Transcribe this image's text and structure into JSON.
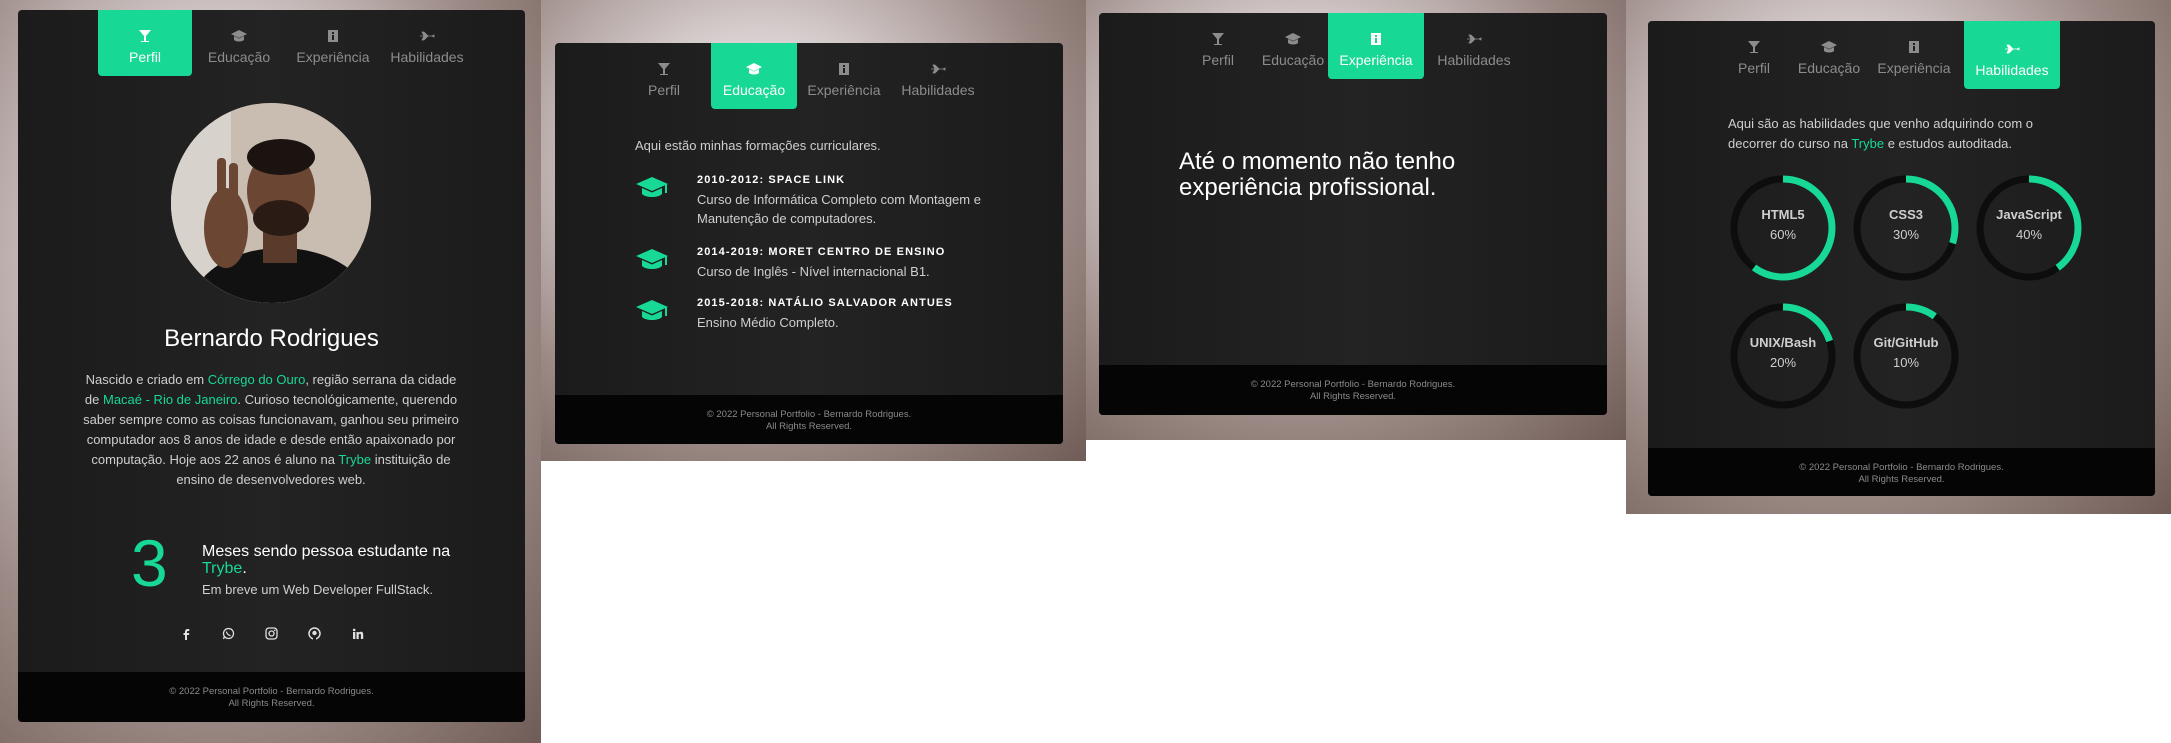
{
  "nav": [
    "Perfil",
    "Educação",
    "Experiência",
    "Habilidades"
  ],
  "profile": {
    "name": "Bernardo Rodrigues",
    "bio": [
      {
        "text": "Nascido e criado em "
      },
      {
        "text": "Córrego do Ouro",
        "hl": true
      },
      {
        "text": ", região serrana da cidade de "
      },
      {
        "text": "Macaé - Rio de Janeiro",
        "hl": true
      },
      {
        "text": ". Curioso tecnológicamente, querendo saber sempre como as coisas funcionavam, ganhou seu primeiro computador aos 8 anos de idade e desde então apaixonado por computação. Hoje aos 22 anos é aluno na "
      },
      {
        "text": "Trybe",
        "hl": true
      },
      {
        "text": " instituição de ensino de desenvolvedores web."
      }
    ],
    "months": "3",
    "months_text": "Meses sendo pessoa estudante na ",
    "months_link": "Trybe",
    "months_end": ".",
    "months_sub": "Em breve um Web Developer FullStack.",
    "social": [
      "facebook-icon",
      "whatsapp-icon",
      "instagram-icon",
      "github-icon",
      "linkedin-icon"
    ]
  },
  "education": {
    "intro": "Aqui estão minhas formações curriculares.",
    "items": [
      {
        "title": "2010-2012: SPACE LINK",
        "desc": "Curso de Informática Completo com Montagem e Manutenção de computadores."
      },
      {
        "title": "2014-2019: MORET CENTRO DE ENSINO",
        "desc": "Curso de Inglês - Nível internacional B1."
      },
      {
        "title": "2015-2018: NATÁLIO SALVADOR ANTUES",
        "desc": "Ensino Médio Completo."
      }
    ]
  },
  "experience": {
    "text": "Até o momento não tenho experiência profissional."
  },
  "skills": {
    "intro_a": "Aqui são as habilidades que venho adquirindo com o decorrer do curso na ",
    "intro_link": "Trybe",
    "intro_b": " e estudos autoditada.",
    "items": [
      {
        "name": "HTML5",
        "label": "60%",
        "pct": 60
      },
      {
        "name": "CSS3",
        "label": "30%",
        "pct": 30
      },
      {
        "name": "JavaScript",
        "label": "40%",
        "pct": 40
      },
      {
        "name": "UNIX/Bash",
        "label": "20%",
        "pct": 20
      },
      {
        "name": "Git/GitHub",
        "label": "10%",
        "pct": 10
      }
    ]
  },
  "footer": {
    "line1": "© 2022 Personal Portfolio - Bernardo Rodrigues.",
    "line2": "All Rights Reserved."
  },
  "colors": {
    "accent": "#17d895",
    "card": "#1e1e1e",
    "footer": "#050505"
  }
}
